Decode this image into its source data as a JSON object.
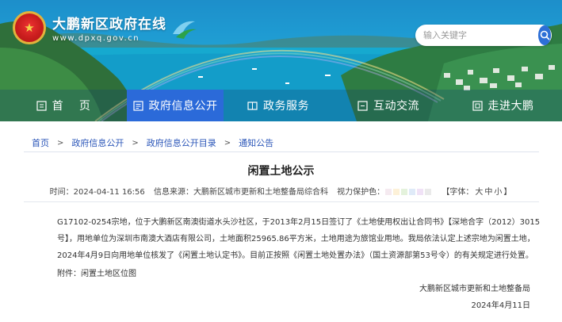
{
  "site": {
    "title": "大鹏新区政府在线",
    "url": "www.dpxq.gov.cn"
  },
  "search": {
    "placeholder": "输入关键字"
  },
  "nav": {
    "items": [
      {
        "label": "首    页",
        "icon": "home-icon"
      },
      {
        "label": "政府信息公开",
        "icon": "document-icon",
        "active": true
      },
      {
        "label": "政务服务",
        "icon": "service-icon"
      },
      {
        "label": "互动交流",
        "icon": "chat-icon"
      },
      {
        "label": "走进大鹏",
        "icon": "building-icon"
      }
    ]
  },
  "breadcrumb": [
    "首页",
    "政府信息公开",
    "政府信息公开目录",
    "通知公告"
  ],
  "breadcrumb_sep": ">",
  "article": {
    "title": "闲置土地公示",
    "time": "时间：2024-04-11 16:56",
    "source": "信息来源：大鹏新区城市更新和土地整备局综合科",
    "vision": "视力保护色：",
    "vision_colors": [
      "#f5eaf0",
      "#fdf1d8",
      "#e4f2dc",
      "#dfeaf8",
      "#f0e2f6",
      "#eaeaea"
    ],
    "font_label_open": "【字体：",
    "font_large": "大",
    "font_medium": "中",
    "font_small": "小",
    "font_label_close": "】",
    "body": "G17102-0254宗地，位于大鹏新区南澳街道水头沙社区，于2013年2月15日签订了《土地使用权出让合同书》【深地合字（2012）3015号】，用地单位为深圳市南澳大酒店有限公司，土地面积25965.86平方米，土地用途为旅馆业用地。我局依法认定上述宗地为闲置土地，2024年4月9日向用地单位核发了《闲置土地认定书》。目前正按照《闲置土地处置办法》（国土资源部第53号令）的有关规定进行处置。",
    "attachment": "附件：闲置土地区位图",
    "sign_org": "大鹏新区城市更新和土地整备局",
    "sign_date": "2024年4月11日"
  },
  "colors": {
    "nav_active": "#2b6ad9",
    "link": "#2a55b8",
    "search_button": "#2d6fd6"
  }
}
